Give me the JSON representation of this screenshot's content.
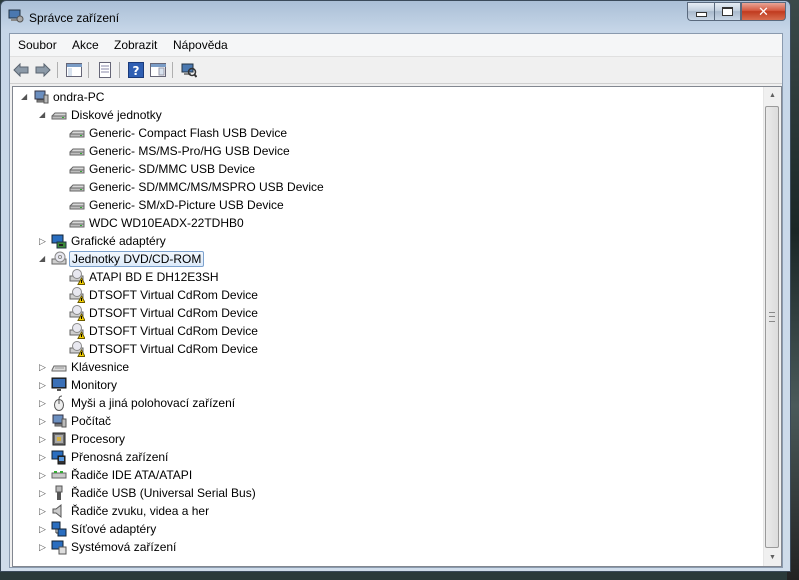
{
  "window": {
    "title": "Správce zařízení"
  },
  "menu": [
    "Soubor",
    "Akce",
    "Zobrazit",
    "Nápověda"
  ],
  "toolbar": {
    "buttons": [
      "back-arrow-icon",
      "forward-arrow-icon",
      "show-hide-tree-icon",
      "properties-icon",
      "help-icon",
      "details-pane-icon",
      "scan-hardware-icon"
    ]
  },
  "tree": {
    "root": "ondra-PC",
    "categories": [
      {
        "label": "Diskové jednotky",
        "expanded": true,
        "icon": "disk-drive-icon",
        "children": [
          {
            "label": "Generic- Compact Flash USB Device",
            "icon": "disk-drive-icon"
          },
          {
            "label": "Generic- MS/MS-Pro/HG USB Device",
            "icon": "disk-drive-icon"
          },
          {
            "label": "Generic- SD/MMC USB Device",
            "icon": "disk-drive-icon"
          },
          {
            "label": "Generic- SD/MMC/MS/MSPRO USB Device",
            "icon": "disk-drive-icon"
          },
          {
            "label": "Generic- SM/xD-Picture USB Device",
            "icon": "disk-drive-icon"
          },
          {
            "label": "WDC WD10EADX-22TDHB0",
            "icon": "disk-drive-icon"
          }
        ]
      },
      {
        "label": "Grafické adaptéry",
        "expanded": false,
        "icon": "display-adapter-icon",
        "children": []
      },
      {
        "label": "Jednotky DVD/CD-ROM",
        "expanded": true,
        "selected": true,
        "icon": "cdrom-drive-icon",
        "children": [
          {
            "label": "ATAPI BD  E  DH12E3SH",
            "icon": "cdrom-warning-icon"
          },
          {
            "label": "DTSOFT Virtual CdRom Device",
            "icon": "cdrom-warning-icon"
          },
          {
            "label": "DTSOFT Virtual CdRom Device",
            "icon": "cdrom-warning-icon"
          },
          {
            "label": "DTSOFT Virtual CdRom Device",
            "icon": "cdrom-warning-icon"
          },
          {
            "label": "DTSOFT Virtual CdRom Device",
            "icon": "cdrom-warning-icon"
          }
        ]
      },
      {
        "label": "Klávesnice",
        "expanded": false,
        "icon": "keyboard-icon",
        "children": []
      },
      {
        "label": "Monitory",
        "expanded": false,
        "icon": "monitor-icon",
        "children": []
      },
      {
        "label": "Myši a jiná polohovací zařízení",
        "expanded": false,
        "icon": "mouse-icon",
        "children": []
      },
      {
        "label": "Počítač",
        "expanded": false,
        "icon": "computer-icon",
        "children": []
      },
      {
        "label": "Procesory",
        "expanded": false,
        "icon": "processor-icon",
        "children": []
      },
      {
        "label": "Přenosná zařízení",
        "expanded": false,
        "icon": "portable-device-icon",
        "children": []
      },
      {
        "label": "Řadiče IDE ATA/ATAPI",
        "expanded": false,
        "icon": "ide-controller-icon",
        "children": []
      },
      {
        "label": "Řadiče USB (Universal Serial Bus)",
        "expanded": false,
        "icon": "usb-icon",
        "children": []
      },
      {
        "label": "Řadiče zvuku, videa a her",
        "expanded": false,
        "icon": "speaker-icon",
        "children": []
      },
      {
        "label": "Síťové adaptéry",
        "expanded": false,
        "icon": "network-adapter-icon",
        "children": []
      },
      {
        "label": "Systémová zařízení",
        "expanded": false,
        "icon": "system-device-icon",
        "children": []
      }
    ]
  }
}
